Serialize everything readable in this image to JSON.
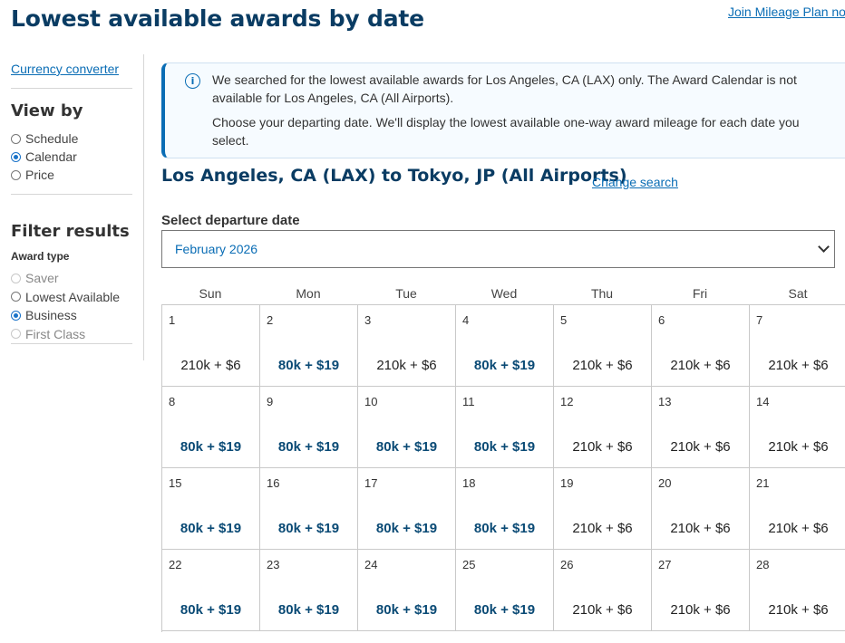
{
  "header": {
    "title": "Lowest available awards by date",
    "join_link": "Join Mileage Plan no"
  },
  "sidebar": {
    "currency_link": "Currency converter",
    "view_by": {
      "heading": "View by",
      "options": [
        {
          "label": "Schedule",
          "checked": false
        },
        {
          "label": "Calendar",
          "checked": true
        },
        {
          "label": "Price",
          "checked": false
        }
      ]
    },
    "filter": {
      "heading": "Filter results",
      "award_type_label": "Award type",
      "options": [
        {
          "label": "Saver",
          "checked": false,
          "disabled": true
        },
        {
          "label": "Lowest Available",
          "checked": false,
          "disabled": false
        },
        {
          "label": "Business",
          "checked": true,
          "disabled": false
        },
        {
          "label": "First Class",
          "checked": false,
          "disabled": true
        }
      ]
    }
  },
  "notice": {
    "line1": "We searched for the lowest available awards for Los Angeles, CA (LAX) only. The Award Calendar is not available for Los Angeles, CA (All Airports).",
    "line2": "Choose your departing date. We'll display the lowest available one-way award mileage for each date you select."
  },
  "route": {
    "title": "Los Angeles, CA (LAX) to Tokyo, JP (All Airports)",
    "change_link": "Change search"
  },
  "date_select": {
    "label": "Select departure date",
    "value": "February 2026"
  },
  "calendar": {
    "weekdays": [
      "Sun",
      "Mon",
      "Tue",
      "Wed",
      "Thu",
      "Fri",
      "Sat"
    ],
    "days": [
      {
        "day": "1",
        "price": "210k + $6",
        "low": false
      },
      {
        "day": "2",
        "price": "80k + $19",
        "low": true
      },
      {
        "day": "3",
        "price": "210k + $6",
        "low": false
      },
      {
        "day": "4",
        "price": "80k + $19",
        "low": true
      },
      {
        "day": "5",
        "price": "210k + $6",
        "low": false
      },
      {
        "day": "6",
        "price": "210k + $6",
        "low": false
      },
      {
        "day": "7",
        "price": "210k + $6",
        "low": false
      },
      {
        "day": "8",
        "price": "80k + $19",
        "low": true
      },
      {
        "day": "9",
        "price": "80k + $19",
        "low": true
      },
      {
        "day": "10",
        "price": "80k + $19",
        "low": true
      },
      {
        "day": "11",
        "price": "80k + $19",
        "low": true
      },
      {
        "day": "12",
        "price": "210k + $6",
        "low": false
      },
      {
        "day": "13",
        "price": "210k + $6",
        "low": false
      },
      {
        "day": "14",
        "price": "210k + $6",
        "low": false
      },
      {
        "day": "15",
        "price": "80k + $19",
        "low": true
      },
      {
        "day": "16",
        "price": "80k + $19",
        "low": true
      },
      {
        "day": "17",
        "price": "80k + $19",
        "low": true
      },
      {
        "day": "18",
        "price": "80k + $19",
        "low": true
      },
      {
        "day": "19",
        "price": "210k + $6",
        "low": false
      },
      {
        "day": "20",
        "price": "210k + $6",
        "low": false
      },
      {
        "day": "21",
        "price": "210k + $6",
        "low": false
      },
      {
        "day": "22",
        "price": "80k + $19",
        "low": true
      },
      {
        "day": "23",
        "price": "80k + $19",
        "low": true
      },
      {
        "day": "24",
        "price": "80k + $19",
        "low": true
      },
      {
        "day": "25",
        "price": "80k + $19",
        "low": true
      },
      {
        "day": "26",
        "price": "210k + $6",
        "low": false
      },
      {
        "day": "27",
        "price": "210k + $6",
        "low": false
      },
      {
        "day": "28",
        "price": "210k + $6",
        "low": false
      }
    ]
  },
  "colors": {
    "brand_dark": "#0a3c63",
    "link": "#0a6db5",
    "lowest_price": "#0a4a75"
  }
}
